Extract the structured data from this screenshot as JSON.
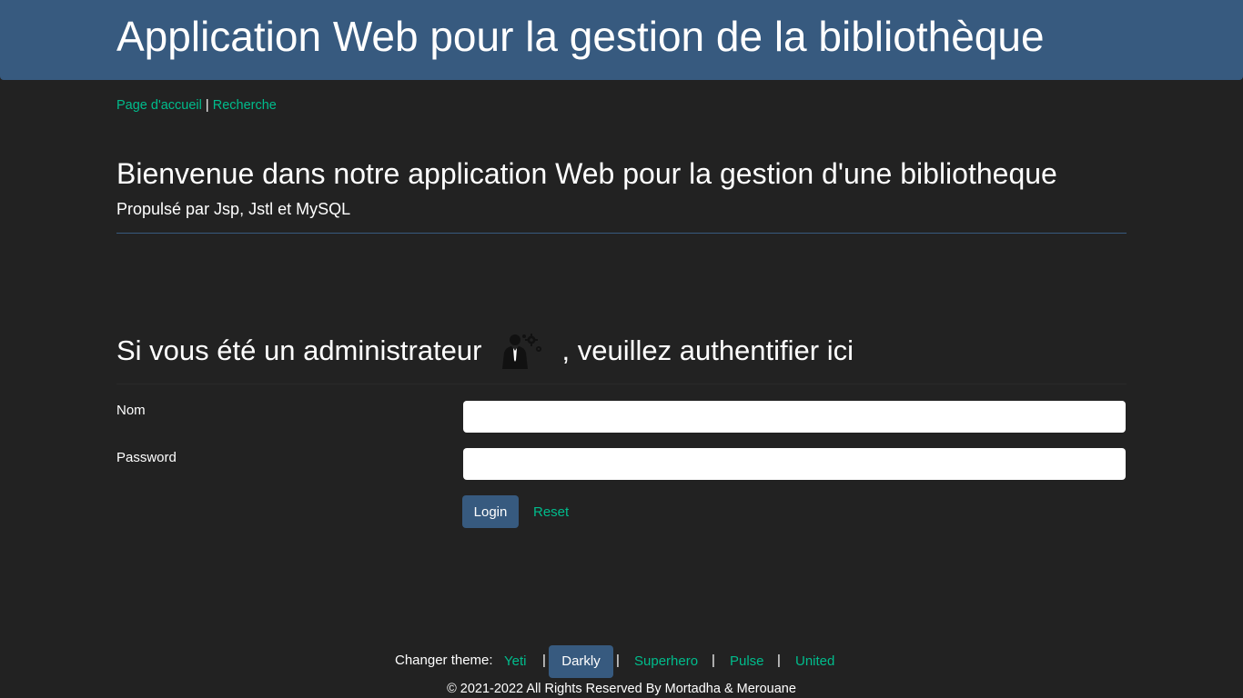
{
  "header": {
    "title": "Application Web pour la gestion de la bibliothèque"
  },
  "nav": {
    "home_link": "Page d'accueil",
    "separator": "|",
    "search_link": "Recherche"
  },
  "welcome": {
    "title": "Bienvenue dans notre application Web pour la gestion d'une bibliotheque",
    "subtitle": "Propulsé par Jsp, Jstl et MySQL"
  },
  "login": {
    "heading_prefix": "Si vous été un administrateur",
    "heading_suffix": ", veuillez authentifier ici",
    "heading_icon": "admin-user-gear-icon",
    "name_label": "Nom",
    "name_value": "",
    "password_label": "Password",
    "password_value": "",
    "login_button": "Login",
    "reset_link": "Reset"
  },
  "theme_switcher": {
    "label": "Changer theme:",
    "separator": "|",
    "themes": [
      "Yeti",
      "Darkly",
      "Superhero",
      "Pulse",
      "United"
    ],
    "active": "Darkly"
  },
  "footer": {
    "copyright": "© 2021-2022 All Rights Reserved By Mortadha & Merouane"
  },
  "colors": {
    "background": "#222222",
    "primary": "#375a7f",
    "link": "#00bc8c",
    "text": "#ffffff"
  }
}
